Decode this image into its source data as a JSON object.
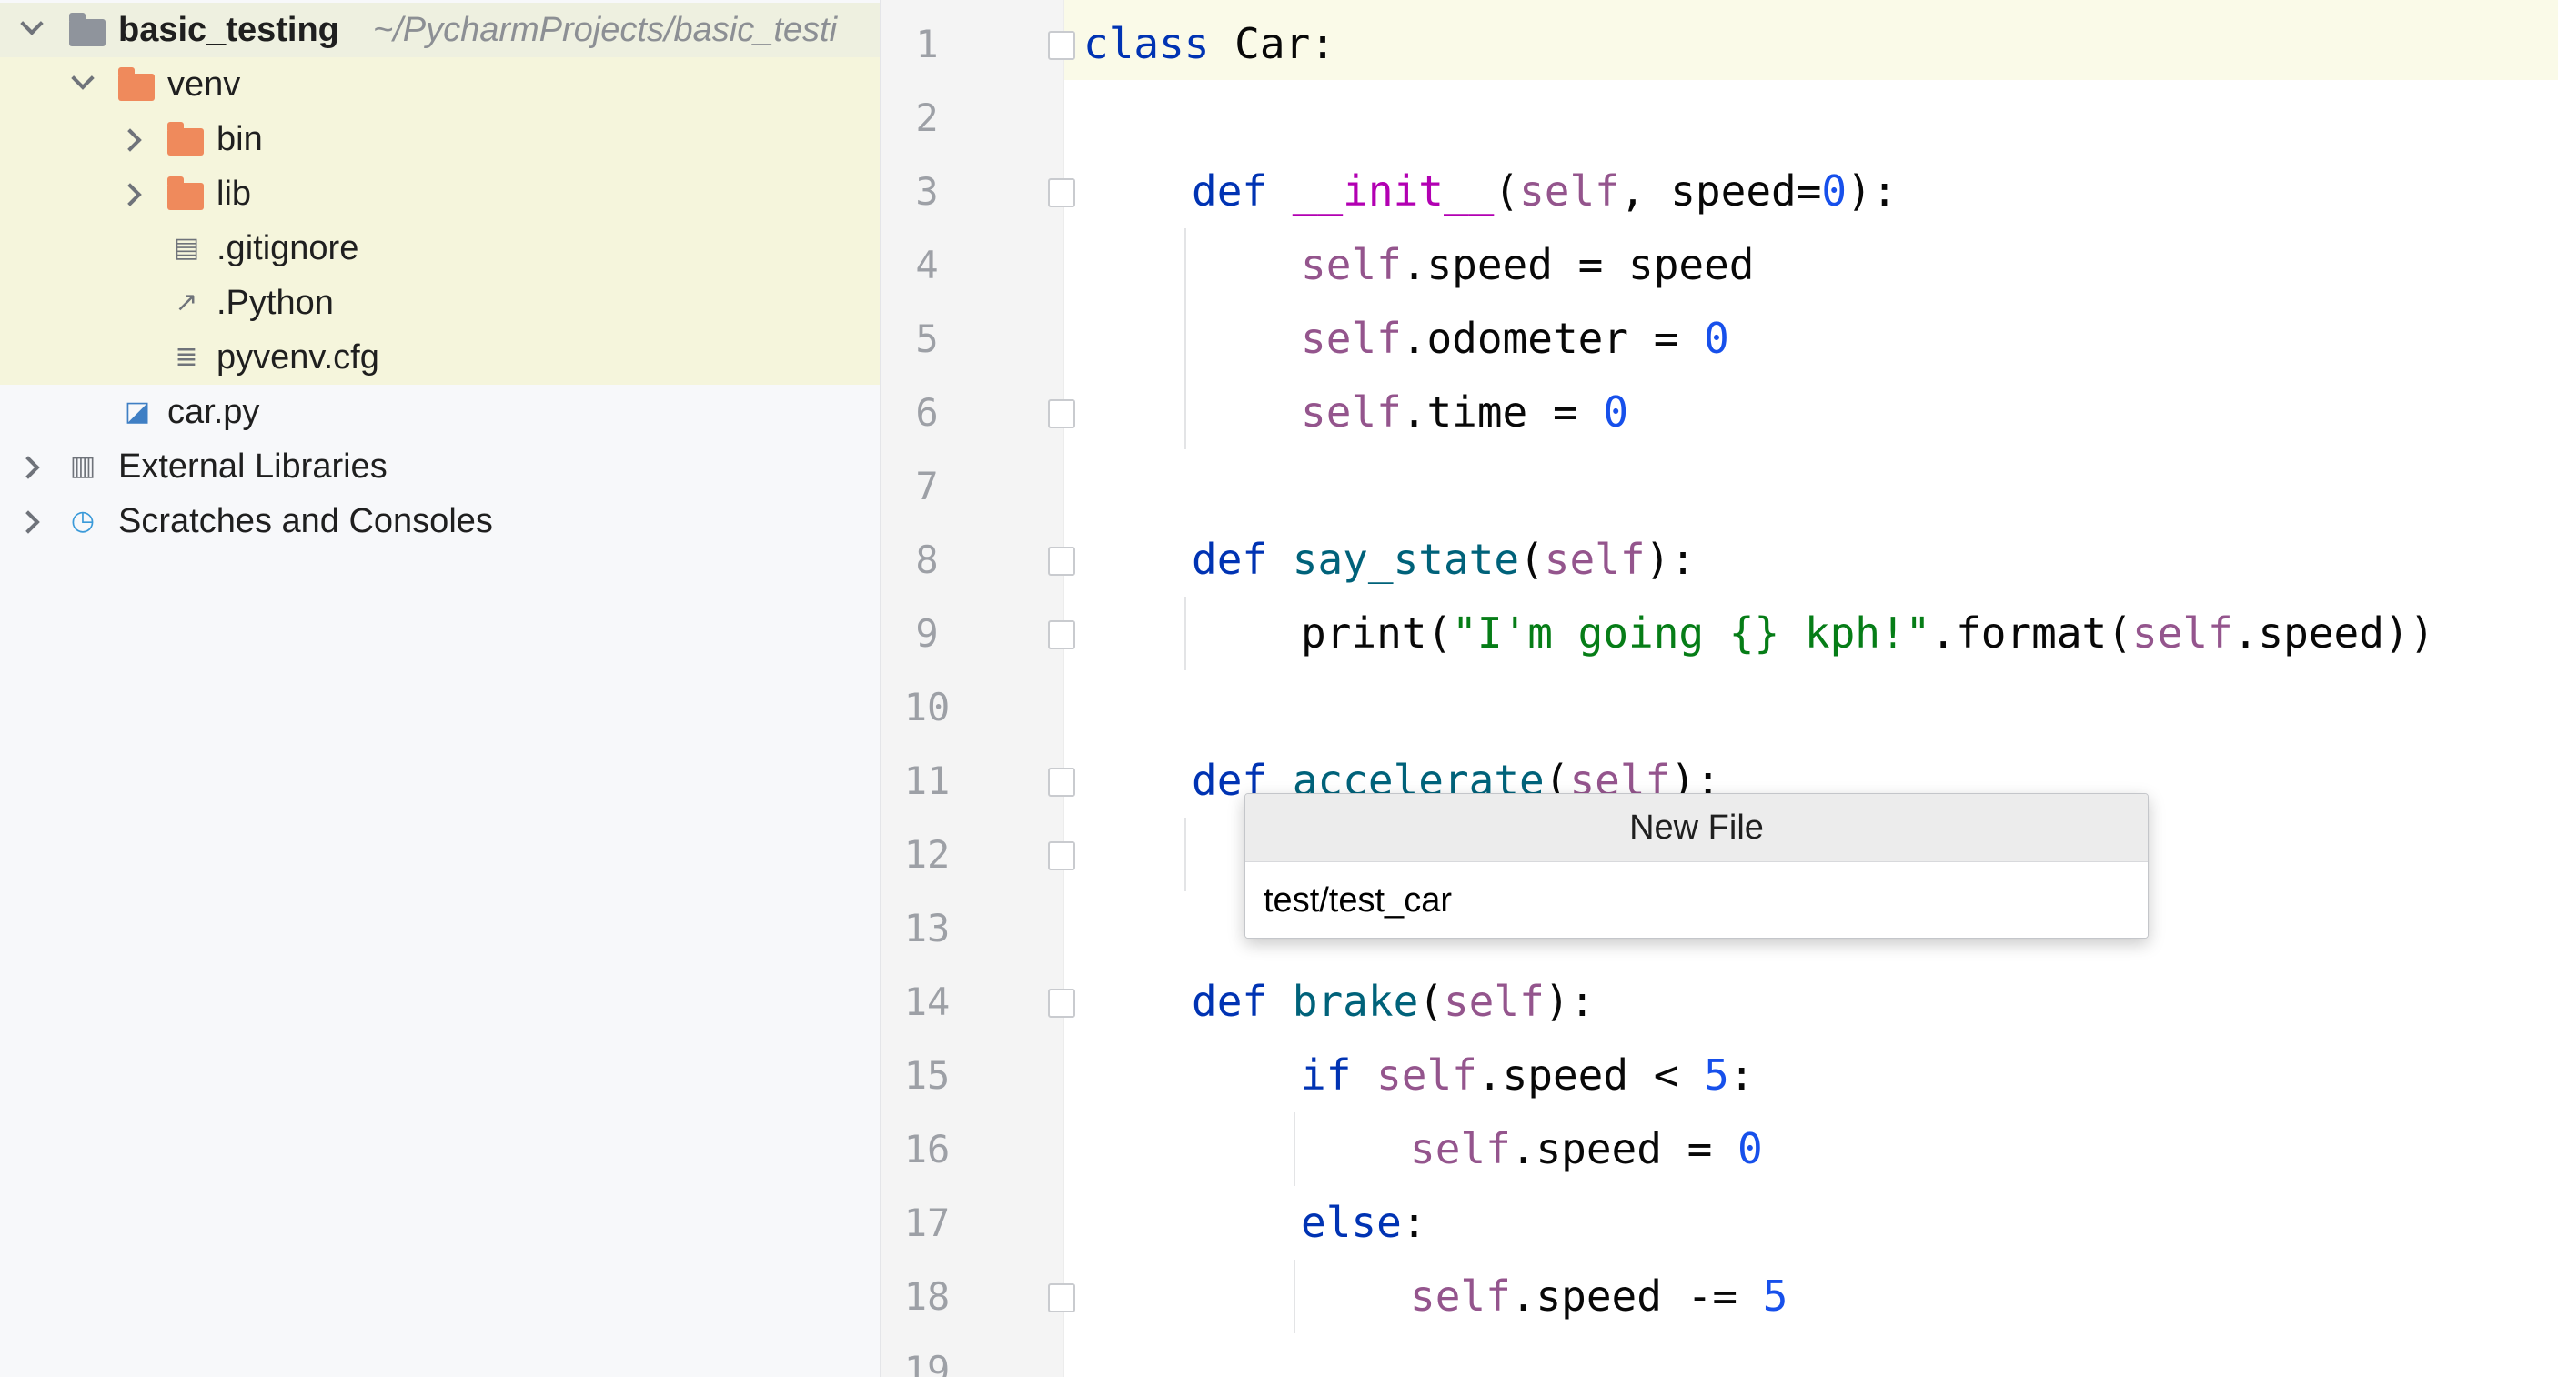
{
  "project_tree": {
    "root": {
      "name": "basic_testing",
      "path": "~/PycharmProjects/basic_testi"
    },
    "items": [
      {
        "label": "venv"
      },
      {
        "label": "bin"
      },
      {
        "label": "lib"
      },
      {
        "label": ".gitignore"
      },
      {
        "label": ".Python"
      },
      {
        "label": "pyvenv.cfg"
      },
      {
        "label": "car.py"
      },
      {
        "label": "External Libraries"
      },
      {
        "label": "Scratches and Consoles"
      }
    ]
  },
  "editor": {
    "line_numbers": [
      "1",
      "2",
      "3",
      "4",
      "5",
      "6",
      "7",
      "8",
      "9",
      "10",
      "11",
      "12",
      "13",
      "14",
      "15",
      "16",
      "17",
      "18",
      "19"
    ]
  },
  "new_file_dialog": {
    "title": "New File",
    "value": "test/test_car"
  }
}
